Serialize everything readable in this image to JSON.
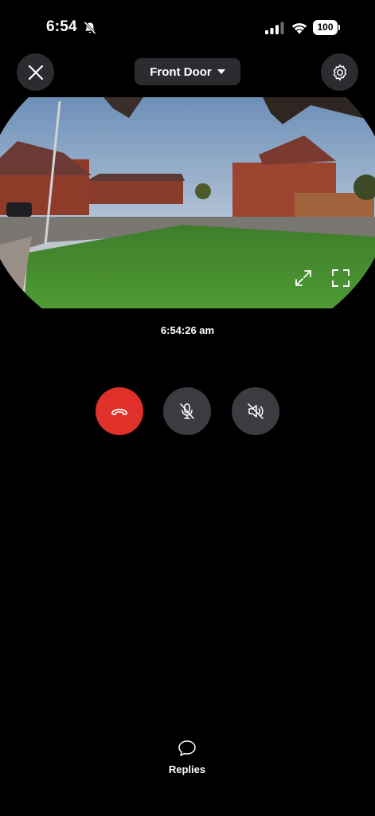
{
  "status_bar": {
    "time": "6:54",
    "battery": "100"
  },
  "header": {
    "device_name": "Front Door"
  },
  "live_view": {
    "timestamp": "6:54:26 am"
  },
  "controls": {
    "end_call_color": "#e0302a",
    "button_color": "#3a3c41"
  },
  "footer": {
    "replies_label": "Replies"
  }
}
